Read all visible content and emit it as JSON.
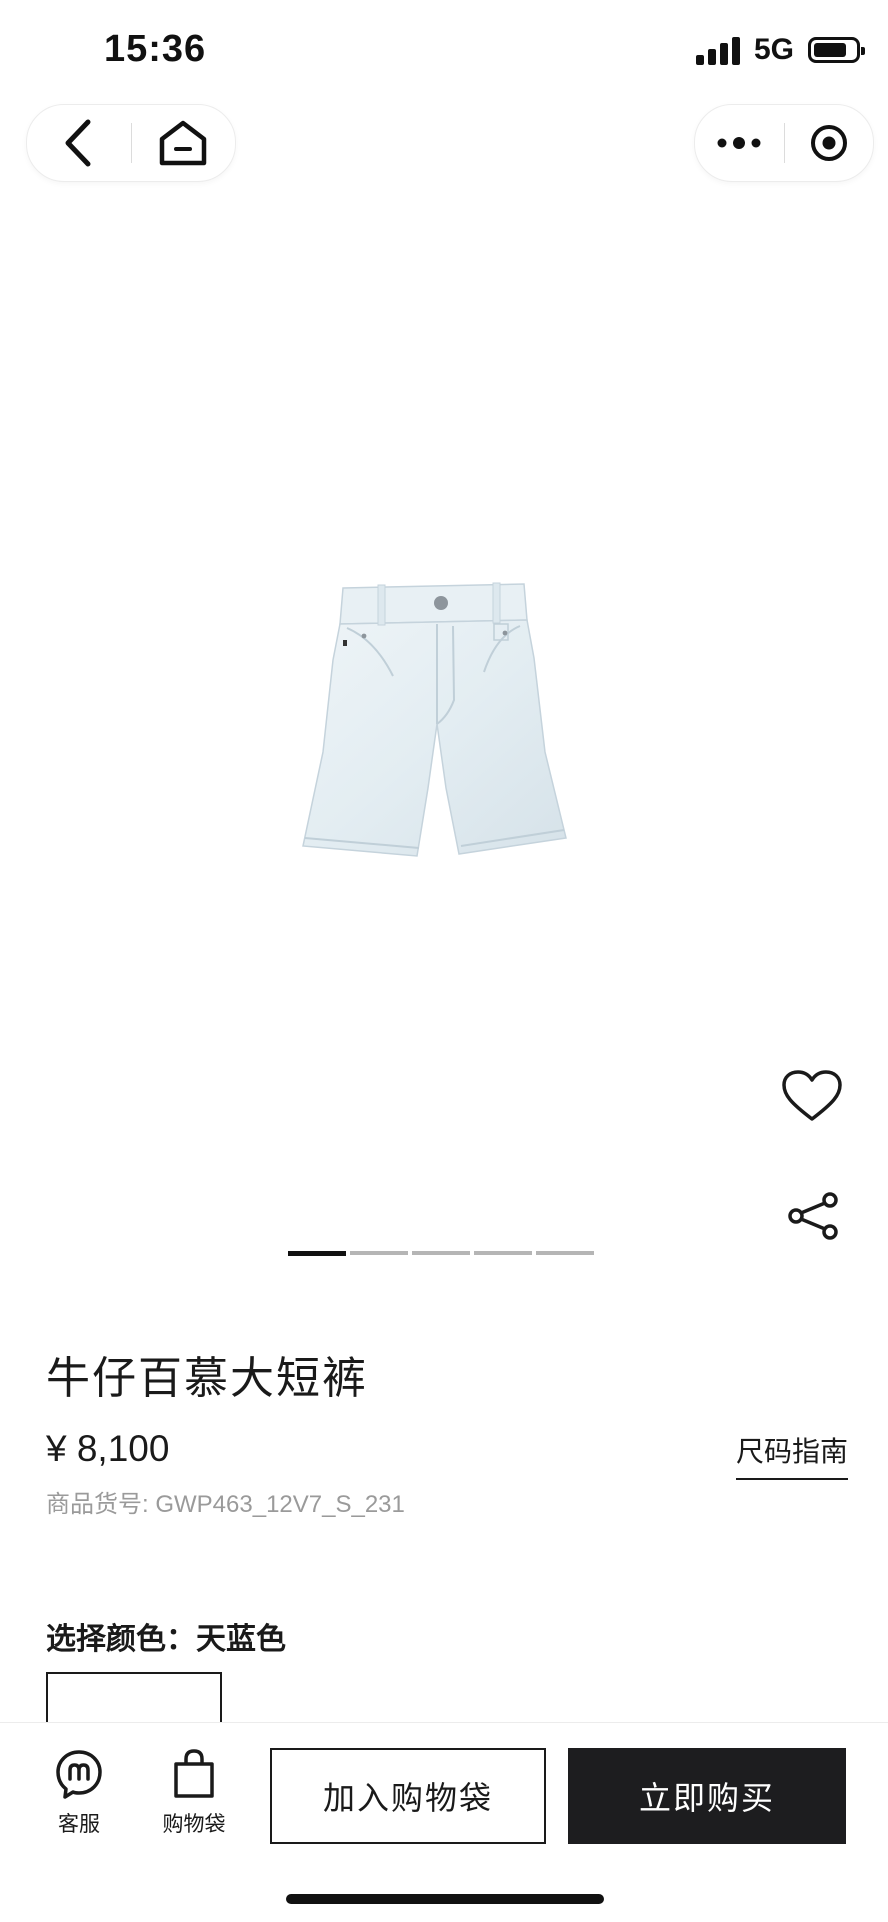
{
  "status_bar": {
    "time": "15:36",
    "network": "5G",
    "battery_level": 0.8
  },
  "nav": {
    "back_icon": "chevron-left-icon",
    "home_icon": "home-icon",
    "more_icon": "more-dots-icon",
    "close_icon": "target-circle-icon"
  },
  "gallery": {
    "image_count": 5,
    "active_index": 0,
    "favorite_icon": "heart-outline-icon",
    "share_icon": "share-icon"
  },
  "product": {
    "name": "牛仔百慕大短裤",
    "price": "¥ 8,100",
    "sku_label": "商品货号:",
    "sku": "GWP463_12V7_S_231",
    "size_guide": "尺码指南",
    "color_label": "选择颜色：",
    "color_value": "天蓝色"
  },
  "bottom_bar": {
    "service_label": "客服",
    "bag_label": "购物袋",
    "add_to_bag": "加入购物袋",
    "buy_now": "立即购买"
  },
  "colors": {
    "accent": "#1d1d1f",
    "denim": "#e6eff4"
  }
}
